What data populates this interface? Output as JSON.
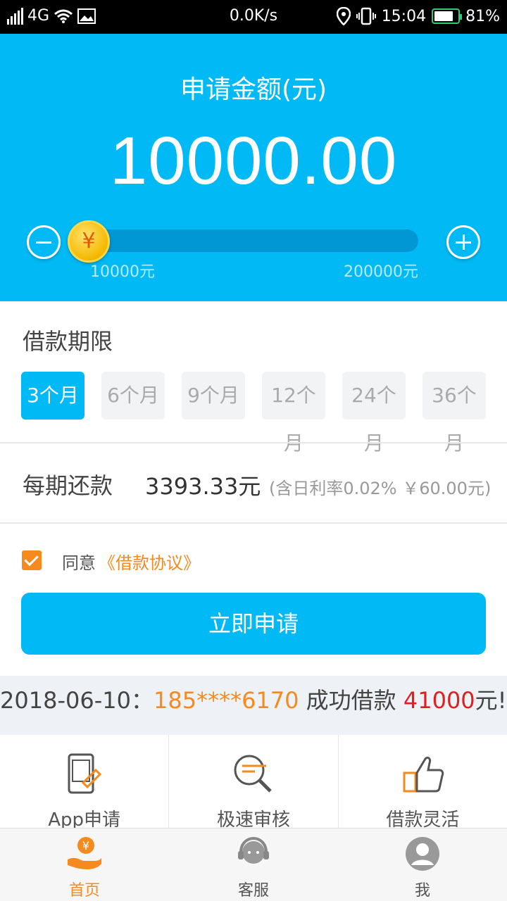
{
  "status_bar": {
    "network": "4G",
    "speed": "0.0K/s",
    "time": "15:04",
    "battery": "81%",
    "battery_level": 0.81
  },
  "hero": {
    "label": "申请金额(元)",
    "amount": "10000.00",
    "range_min": "10000元",
    "range_max": "200000元",
    "slider_fraction": 0.0,
    "coin_symbol": "¥"
  },
  "term": {
    "title": "借款期限",
    "options": [
      "3个月",
      "6个月",
      "9个月",
      "12个月",
      "24个月",
      "36个月"
    ],
    "selected_index": 0
  },
  "repayment": {
    "label": "每期还款",
    "value": "3393.33元",
    "note": "(含日利率0.02% ￥60.00元)"
  },
  "agreement": {
    "checked": true,
    "text": "同意",
    "link": "《借款协议》"
  },
  "apply_button": "立即申请",
  "ticker": {
    "date": "2018-06-10：",
    "phone": "185****6170",
    "text": " 成功借款 ",
    "amount": "41000",
    "suffix": "元!"
  },
  "features": [
    {
      "label": "App申请",
      "icon": "phone-apply-icon"
    },
    {
      "label": "极速审核",
      "icon": "magnifier-icon"
    },
    {
      "label": "借款灵活",
      "icon": "thumbs-up-icon"
    }
  ],
  "tabs": [
    {
      "label": "首页",
      "icon": "home-yuan-icon",
      "active": true
    },
    {
      "label": "客服",
      "icon": "customer-service-icon",
      "active": false
    },
    {
      "label": "我",
      "icon": "user-profile-icon",
      "active": false
    }
  ],
  "colors": {
    "primary": "#01b9f4",
    "accent": "#f68a1e",
    "highlight_red": "#e02020"
  }
}
